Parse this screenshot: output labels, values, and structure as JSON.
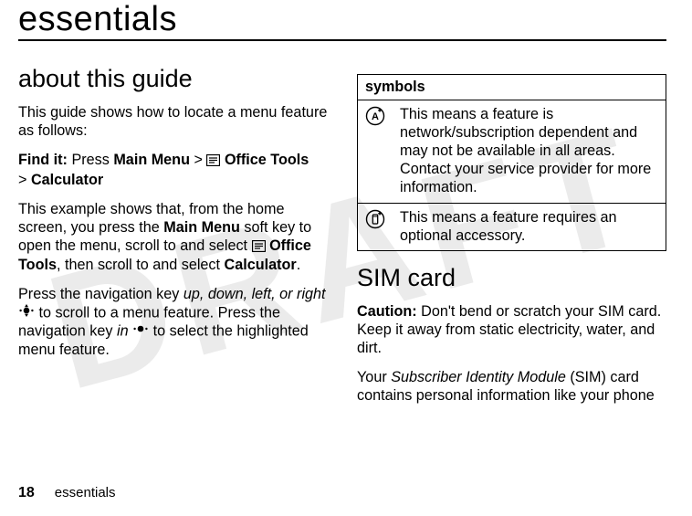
{
  "watermark": "DRAFT",
  "chapter_title": "essentials",
  "left": {
    "section_title": "about this guide",
    "intro": "This guide shows how to locate a menu feature as follows:",
    "find_it_label": "Find it:",
    "find_it_press": "Press",
    "main_menu": "Main Menu",
    "gt": ">",
    "office_tools": "Office Tools",
    "calculator": "Calculator",
    "example_pre": "This example shows that, from the home screen, you press the ",
    "example_mid1": " soft key to open the menu, scroll to and select ",
    "example_mid2": ", then scroll to and select ",
    "period": ".",
    "nav_pre": "Press the navigation key ",
    "nav_italic": "up, down, left, or right",
    "nav_mid": " to scroll to a menu feature. Press the navigation key ",
    "nav_in": "in",
    "nav_end": " to select the highlighted menu feature."
  },
  "right": {
    "symbols_header": "symbols",
    "rows": [
      {
        "desc": "This means a feature is network/subscription dependent and may not be available in all areas. Contact your service provider for more information."
      },
      {
        "desc": "This means a feature requires an optional accessory."
      }
    ],
    "sim_title": "SIM card",
    "caution_label": "Caution:",
    "caution_text": " Don't bend or scratch your SIM card. Keep it away from static electricity, water, and dirt.",
    "sim_p2_pre": "Your ",
    "sim_p2_italic": "Subscriber Identity Module",
    "sim_p2_post": " (SIM) card contains personal information like your phone"
  },
  "footer": {
    "page_number": "18",
    "running": "essentials"
  }
}
